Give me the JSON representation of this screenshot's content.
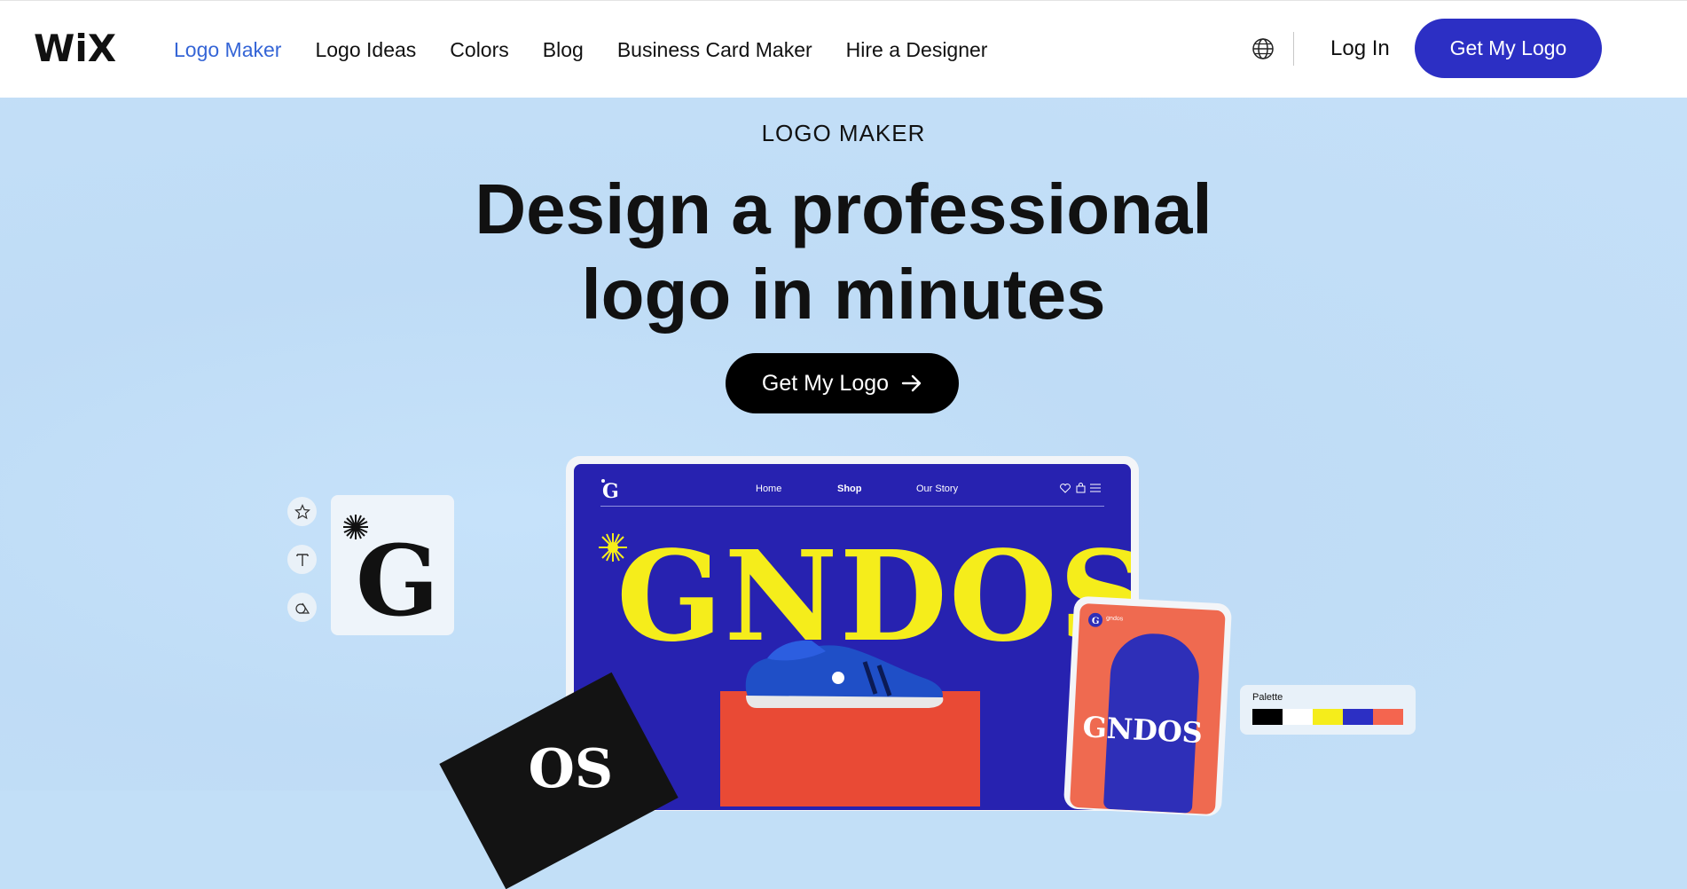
{
  "header": {
    "brand": "WiX",
    "nav": [
      {
        "label": "Logo Maker",
        "active": true
      },
      {
        "label": "Logo Ideas",
        "active": false
      },
      {
        "label": "Colors",
        "active": false
      },
      {
        "label": "Blog",
        "active": false
      },
      {
        "label": "Business Card Maker",
        "active": false
      },
      {
        "label": "Hire a Designer",
        "active": false
      }
    ],
    "language_icon": "globe-icon",
    "login_label": "Log In",
    "cta_label": "Get My Logo"
  },
  "hero": {
    "eyebrow": "LOGO MAKER",
    "headline_line1": "Design a professional",
    "headline_line2": "logo in minutes",
    "cta_label": "Get My Logo",
    "cta_icon": "arrow-right-icon"
  },
  "illustration": {
    "tools": [
      "star-icon",
      "text-icon",
      "shapes-icon"
    ],
    "mock_site": {
      "nav": [
        "Home",
        "Shop",
        "Our Story"
      ],
      "brand": "GNDOS",
      "icons": [
        "heart-icon",
        "bag-icon",
        "menu-icon"
      ]
    },
    "phone": {
      "account": "gndos",
      "brand": "GNDOS"
    },
    "palette": {
      "label": "Palette",
      "colors": [
        "#000000",
        "#ffffff",
        "#f5ed1b",
        "#2c2fc4",
        "#f4654f"
      ]
    }
  },
  "colors": {
    "accent": "#2c2fc4",
    "active_nav": "#3565d6",
    "hero_bg": "#c2dff7"
  }
}
